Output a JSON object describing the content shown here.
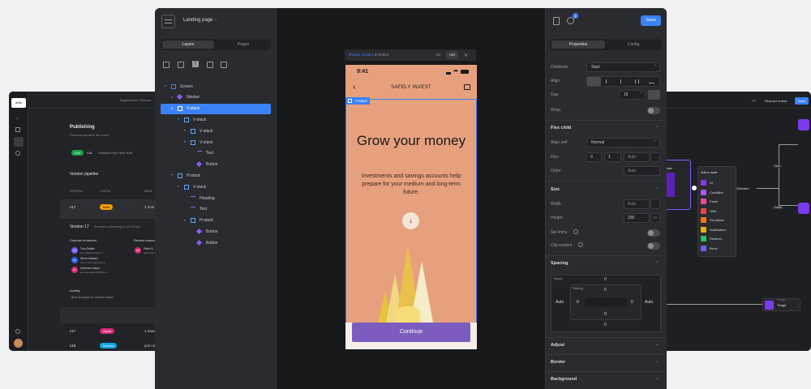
{
  "left_window": {
    "brand": "drfts",
    "breadcrumb": "Experiences / Person",
    "section_title": "Publishing",
    "section_subtitle": "Personal pension life cover",
    "live_badge": "Live",
    "version_current": "v16",
    "published_by": "Published by Peter Bart",
    "pipeline_title": "Version pipeline",
    "table_headers": [
      "VERSION",
      "STATUS",
      "MADE"
    ],
    "pipeline_row": {
      "version": "v17",
      "status": "Beta",
      "made": "2 hours"
    },
    "version_detail_title": "Version 17",
    "version_detail_meta": "Promoted to Beta Aug 24 at 4:32 pm",
    "channel_reviewers_label": "Channel reviewers",
    "review_requests_label": "Review reques",
    "reviewers": [
      {
        "initials": "TS",
        "name": "Tom Sattler",
        "email": "tom.sattler@drfsts.io",
        "color": "#7c5cff"
      },
      {
        "initials": "SH",
        "name": "Steve Herbert",
        "email": "steve.herbert@drfsts.io",
        "color": "#2563eb"
      },
      {
        "initials": "GS",
        "name": "Gemma Draper",
        "email": "gemma.draper@drfsts.io",
        "color": "#db2777"
      }
    ],
    "review_request": {
      "initials": "PB",
      "name": "Peter B",
      "email": "peter.b@drfsts"
    },
    "activity_label": "Activity",
    "activity_item": "Beta accepted by Gemma Draper",
    "bottom_rows": [
      {
        "version": "v17",
        "status": "Alpha",
        "made": "4 days",
        "color": "#db2777"
      },
      {
        "version": "v18",
        "status": "Review",
        "made": "just no",
        "color": "#0ea5e9"
      }
    ]
  },
  "right_window": {
    "request_review": "Request review",
    "save": "Save",
    "add_node_title": "Add a node",
    "node_items": [
      {
        "label": "UI",
        "color": "#7c3aed"
      },
      {
        "label": "Condition",
        "color": "#a855f7"
      },
      {
        "label": "Facts",
        "color": "#ec4899"
      },
      {
        "label": "Wait",
        "color": "#ef4444"
      },
      {
        "label": "Set status",
        "color": "#f97316"
      },
      {
        "label": "Notification",
        "color": "#eab308"
      },
      {
        "label": "Redirect",
        "color": "#22c55e"
      },
      {
        "label": "Block",
        "color": "#6366f1"
      }
    ],
    "true_label": "True",
    "false_label": "False",
    "orientation_text": "hOriented",
    "triage_small": "UI Triage",
    "triage": "Triage",
    "node_label": "oles"
  },
  "editor": {
    "page_name": "Landing page",
    "save_label": "Save",
    "notification_count": "1",
    "layers_tab": "Layers",
    "pages_tab": "Pages",
    "properties_tab": "Properties",
    "config_tab": "Config",
    "layers": [
      {
        "label": "Screen",
        "depth": 0,
        "arrow": "▾",
        "kind": "frame",
        "selected": false
      },
      {
        "label": "Navbar",
        "depth": 1,
        "arrow": "▸",
        "kind": "component",
        "selected": false
      },
      {
        "label": "V-stack",
        "depth": 1,
        "arrow": "▾",
        "kind": "stack",
        "selected": true
      },
      {
        "label": "V-stack",
        "depth": 2,
        "arrow": "▾",
        "kind": "stack",
        "selected": false
      },
      {
        "label": "V-stack",
        "depth": 3,
        "arrow": "▾",
        "kind": "stack",
        "selected": false
      },
      {
        "label": "V-stack",
        "depth": 3,
        "arrow": "▾",
        "kind": "stack",
        "selected": false
      },
      {
        "label": "Text",
        "depth": 4,
        "arrow": "",
        "kind": "text",
        "selected": false
      },
      {
        "label": "Button",
        "depth": 4,
        "arrow": "",
        "kind": "component",
        "selected": false
      },
      {
        "label": "H-stack",
        "depth": 1,
        "arrow": "▾",
        "kind": "hstack",
        "selected": false
      },
      {
        "label": "V-stack",
        "depth": 2,
        "arrow": "▾",
        "kind": "stack",
        "selected": false
      },
      {
        "label": "Heading",
        "depth": 3,
        "arrow": "",
        "kind": "heading",
        "selected": false
      },
      {
        "label": "Text",
        "depth": 3,
        "arrow": "",
        "kind": "text",
        "selected": false
      },
      {
        "label": "H-stack",
        "depth": 3,
        "arrow": "▾",
        "kind": "hstack",
        "selected": false
      },
      {
        "label": "Button",
        "depth": 4,
        "arrow": "",
        "kind": "component",
        "selected": false
      },
      {
        "label": "Button",
        "depth": 4,
        "arrow": "",
        "kind": "component",
        "selected": false
      }
    ],
    "device_label": "iPhone 13 Mini",
    "device_size": "· 375×812",
    "breakpoints": [
      "sm",
      "md",
      "lg"
    ],
    "active_breakpoint": "md",
    "selection_label": "V-stack"
  },
  "phone": {
    "time": "9:41",
    "app_title": "SAFELY INVEST",
    "heading": "Grow your money",
    "body": "Investments and savings accounts help prepare for your medium and long-term future.",
    "cta": "Continue",
    "bg_color": "#e7a07d",
    "cta_color": "#7c5cbf"
  },
  "properties": {
    "distribute_label": "Distribute",
    "distribute_value": "Start",
    "align_label": "Align",
    "gap_label": "Gap",
    "gap_value": "16",
    "wrap_label": "Wrap",
    "flex_child_title": "Flex child",
    "align_self_label": "Align self",
    "align_self_value": "Normal",
    "flex_label": "Flex",
    "flex_grow": "0",
    "flex_shrink": "1",
    "flex_basis": "Auto",
    "order_label": "Order",
    "order_placeholder": "Auto",
    "size_title": "Size",
    "width_label": "Width",
    "width_value": "Auto",
    "height_label": "Height",
    "height_value": "200",
    "height_unit": "PX",
    "set_limits_label": "Set limits",
    "clip_content_label": "Clip content",
    "spacing_title": "Spacing",
    "margin_label": "Margin",
    "padding_label": "Padding",
    "spacing_values": {
      "margin_top": "0",
      "margin_bottom": "0",
      "margin_left": "Auto",
      "margin_right": "Auto",
      "padding_top": "0",
      "padding_bottom": "0",
      "padding_left": "0",
      "padding_right": "0"
    },
    "adjust_title": "Adjust",
    "border_title": "Border",
    "background_title": "Background"
  }
}
